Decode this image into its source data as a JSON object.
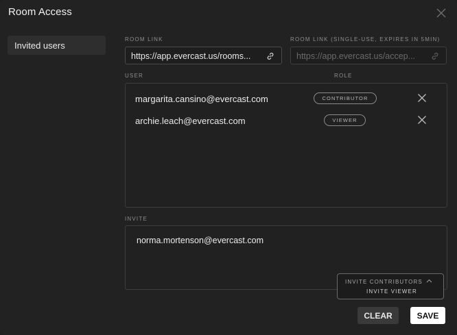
{
  "dialog": {
    "title": "Room Access"
  },
  "sidebar": {
    "items": [
      {
        "label": "Invited users"
      }
    ]
  },
  "room_link": {
    "label": "ROOM LINK",
    "value": "https://app.evercast.us/rooms..."
  },
  "room_link_single": {
    "label": "ROOM LINK (SINGLE-USE, EXPIRES IN 5MIN)",
    "value": "https://app.evercast.us/accep..."
  },
  "users": {
    "col_user": "USER",
    "col_role": "ROLE",
    "rows": [
      {
        "email": "margarita.cansino@evercast.com",
        "role": "CONTRIBUTOR"
      },
      {
        "email": "archie.leach@evercast.com",
        "role": "VIEWER"
      }
    ]
  },
  "invite": {
    "label": "INVITE",
    "value": "norma.mortenson@evercast.com",
    "menu": {
      "selected": "INVITE CONTRIBUTORS",
      "option": "INVITE VIEWER"
    }
  },
  "actions": {
    "clear_label": "CLEAR",
    "save_label": "SAVE"
  }
}
